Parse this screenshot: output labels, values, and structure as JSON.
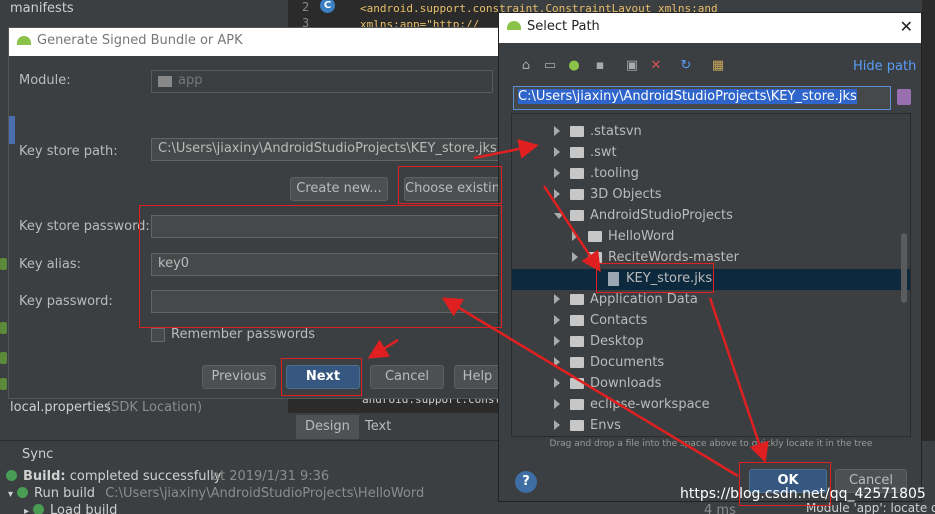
{
  "ide": {
    "project_tree_top": "manifests",
    "local_properties": "local.properties",
    "local_properties_note": "(SDK Location)",
    "editor_line_numbers": [
      "2",
      "3"
    ],
    "editor_code_line1": "<android.support.constraint.ConstraintLayout xmlns:and",
    "editor_code_line2": "    xmlns:app=\"http://",
    "editor_code_bottom": "android.support.constr",
    "tabs": [
      "Design",
      "Text"
    ],
    "sync_tab": "Sync",
    "build_status_label": "Build:",
    "build_status_value": "completed successfully",
    "build_time": "at 2019/1/31 9:36",
    "run_build_label": "Run build",
    "run_build_path": "C:\\Users\\jiaxiny\\AndroidStudioProjects\\HelloWord",
    "load_build": "Load build",
    "build_duration": "4 ms",
    "status_right": "Module 'app': locate o"
  },
  "generate_dialog": {
    "title": "Generate Signed Bundle or APK",
    "module_label": "Module:",
    "module_value": "app",
    "key_store_path_label": "Key store path:",
    "key_store_path_value": "C:\\Users\\jiaxiny\\AndroidStudioProjects\\KEY_store.jks",
    "create_new_button": "Create new...",
    "choose_existing_button": "Choose existin",
    "key_store_password_label": "Key store password:",
    "key_alias_label": "Key alias:",
    "key_alias_value": "key0",
    "key_password_label": "Key password:",
    "remember_passwords_label": "Remember passwords",
    "previous_button": "Previous",
    "next_button": "Next",
    "cancel_button": "Cancel",
    "help_button": "Help"
  },
  "select_path_dialog": {
    "title": "Select Path",
    "hide_path_link": "Hide path",
    "path_value": "C:\\Users\\jiaxiny\\AndroidStudioProjects\\KEY_store.jks",
    "tree": [
      {
        "label": ".statsvn",
        "type": "folder",
        "depth": 0,
        "expanded": false
      },
      {
        "label": ".swt",
        "type": "folder",
        "depth": 0,
        "expanded": false
      },
      {
        "label": ".tooling",
        "type": "folder",
        "depth": 0,
        "expanded": false
      },
      {
        "label": "3D Objects",
        "type": "folder",
        "depth": 0,
        "expanded": false
      },
      {
        "label": "AndroidStudioProjects",
        "type": "folder",
        "depth": 0,
        "expanded": true
      },
      {
        "label": "HelloWord",
        "type": "folder",
        "depth": 1,
        "expanded": false
      },
      {
        "label": "ReciteWords-master",
        "type": "folder",
        "depth": 1,
        "expanded": false
      },
      {
        "label": "KEY_store.jks",
        "type": "file",
        "depth": 2,
        "selected": true
      },
      {
        "label": "Application Data",
        "type": "folder",
        "depth": 0,
        "expanded": false
      },
      {
        "label": "Contacts",
        "type": "folder",
        "depth": 0,
        "expanded": false
      },
      {
        "label": "Desktop",
        "type": "folder",
        "depth": 0,
        "expanded": false
      },
      {
        "label": "Documents",
        "type": "folder",
        "depth": 0,
        "expanded": false
      },
      {
        "label": "Downloads",
        "type": "folder",
        "depth": 0,
        "expanded": false
      },
      {
        "label": "eclipse-workspace",
        "type": "folder",
        "depth": 0,
        "expanded": false
      },
      {
        "label": "Envs",
        "type": "folder",
        "depth": 0,
        "expanded": false
      }
    ],
    "drag_hint": "Drag and drop a file into the space above to quickly locate it in the tree",
    "ok_button": "OK",
    "cancel_button": "Cancel",
    "help_icon": "?"
  },
  "watermark": "https://blog.csdn.net/qq_42571805",
  "colors": {
    "annotation_red": "#e02020",
    "primary_button": "#365880",
    "link_blue": "#589df6",
    "selection": "#2f65ca"
  }
}
